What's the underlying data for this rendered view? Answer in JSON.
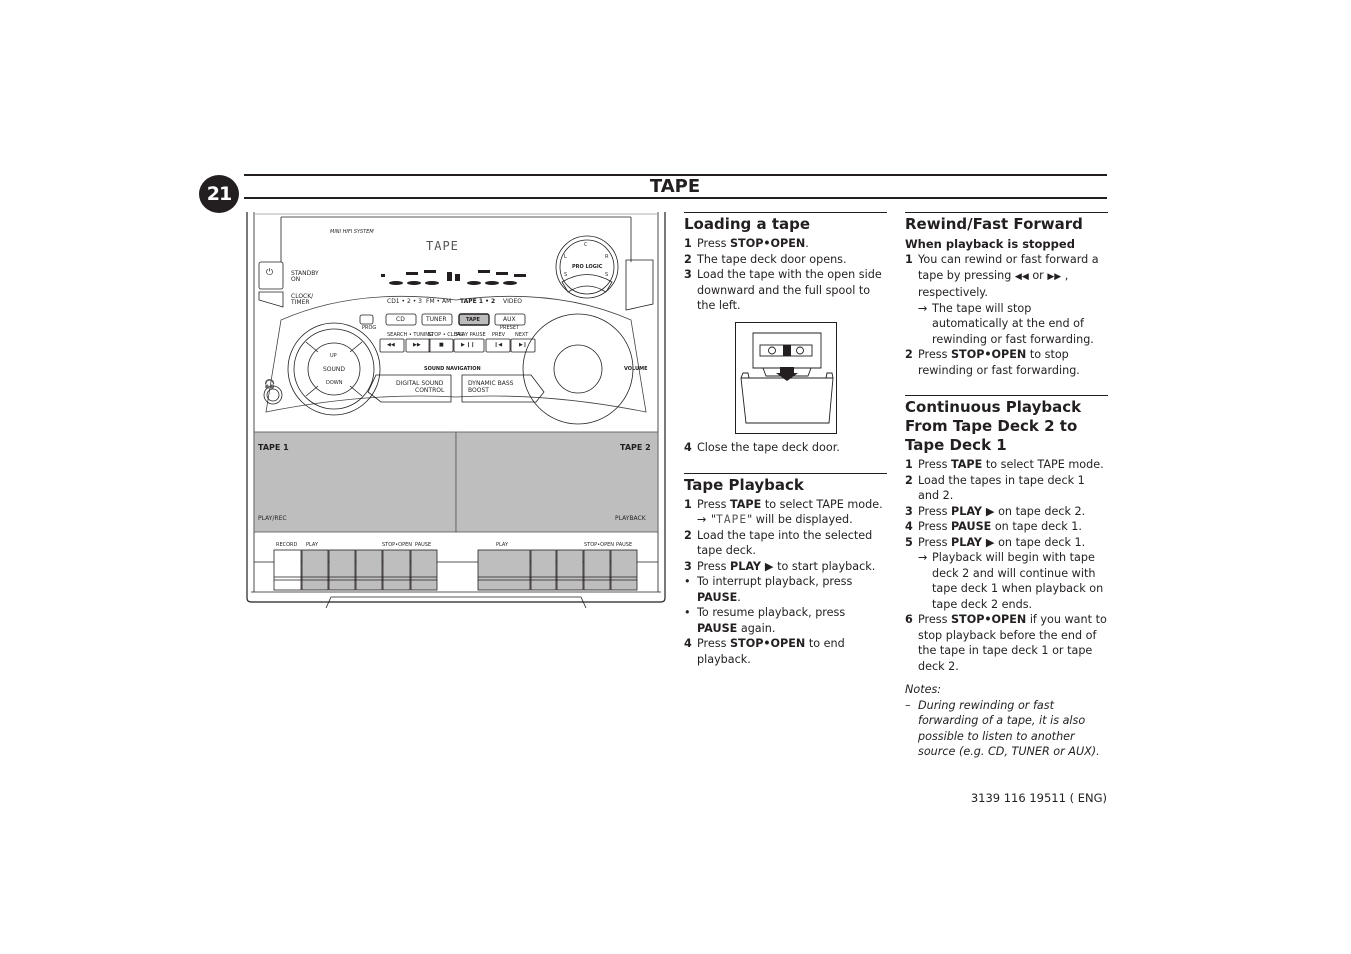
{
  "page": {
    "number": "21",
    "title": "TAPE",
    "footer_code": "3139 116 19511 ( ENG)"
  },
  "device": {
    "brand_label": "MINI HIFI SYSTEM",
    "display_text": "TAPE",
    "standby_label": "STANDBY",
    "standby_label2": "ON",
    "clock_label": "CLOCK/",
    "clock_label2": "TIMER",
    "pro_logic_label": "PRO LOGIC",
    "pro_logic_keys": [
      "C",
      "L",
      "R",
      "S",
      "S"
    ],
    "source_labels": [
      "CD1 • 2 • 3",
      "FM • AM",
      "TAPE 1 • 2",
      "VIDEO"
    ],
    "source_buttons": [
      "CD",
      "TUNER",
      "TAPE",
      "AUX"
    ],
    "prog_label": "PROG",
    "preset_label": "PRESET",
    "transport_labels": [
      "SEARCH • TUNING",
      "STOP • CLEAR",
      "PLAY PAUSE",
      "PREV",
      "NEXT"
    ],
    "transport_glyphs": [
      "◀◀",
      "▶▶",
      "■",
      "▶  ❙❙",
      "❙◀",
      "▶❙"
    ],
    "sound_label": "SOUND",
    "up_label": "UP",
    "down_label": "DOWN",
    "sound_navigation_label": "SOUND NAVIGATION",
    "dsc_label": "DIGITAL SOUND",
    "dsc_label2": "CONTROL",
    "dbb_label": "DYNAMIC BASS",
    "dbb_label2": "BOOST",
    "volume_label": "VOLUME",
    "tape1_label": "TAPE 1",
    "tape1_sub": "PLAY/REC",
    "tape2_label": "TAPE 2",
    "tape2_sub": "PLAYBACK",
    "deck1_keys": [
      "RECORD",
      "PLAY",
      "STOP•OPEN",
      "PAUSE"
    ],
    "deck2_keys": [
      "PLAY",
      "STOP•OPEN",
      "PAUSE"
    ]
  },
  "loading": {
    "heading": "Loading a tape",
    "steps": [
      {
        "num": "1",
        "pre": "Press ",
        "bold": "STOP•OPEN",
        "post": "."
      },
      {
        "num": "2",
        "text": "The tape deck door opens."
      },
      {
        "num": "3",
        "text": "Load the tape with the open side downward and the full spool to the left."
      },
      {
        "num": "4",
        "text": "Close the tape deck door."
      }
    ]
  },
  "playback": {
    "heading": "Tape Playback",
    "step1_num": "1",
    "step1_pre": "Press ",
    "step1_bold": "TAPE",
    "step1_post": " to select TAPE mode.",
    "step1_arrow": "→",
    "step1_result_pre": "\"",
    "step1_result_lcd": "TAPE",
    "step1_result_post": "\" will be displayed.",
    "step2_num": "2",
    "step2_text": "Load the tape into the selected tape deck.",
    "step3_num": "3",
    "step3_pre": "Press ",
    "step3_bold": "PLAY ▶",
    "step3_post": "  to start playback.",
    "bullet_glyph": "•",
    "bullet1_pre": "To interrupt playback, press ",
    "bullet1_bold": "PAUSE",
    "bullet1_post": ".",
    "bullet2_pre": "To resume playback, press ",
    "bullet2_bold": "PAUSE",
    "bullet2_post": " again.",
    "step4_num": "4",
    "step4_pre": "Press ",
    "step4_bold": "STOP•OPEN",
    "step4_post": " to end playback."
  },
  "rewind": {
    "heading": "Rewind/Fast Forward",
    "subheading": "When playback is stopped",
    "step1_num": "1",
    "step1_pre": "You can rewind or fast forward a tape by pressing ",
    "step1_rew": "◀◀",
    "step1_mid": " or ",
    "step1_ff": "▶▶",
    "step1_post": " , respectively.",
    "step1_arrow": "→",
    "step1_result": "The tape will stop automatically at the end of rewinding or fast forwarding.",
    "step2_num": "2",
    "step2_pre": "Press ",
    "step2_bold": "STOP•OPEN",
    "step2_post": " to stop rewinding or fast forwarding."
  },
  "continuous": {
    "heading": "Continuous Playback From Tape Deck 2 to Tape Deck 1",
    "s1_num": "1",
    "s1_pre": "Press ",
    "s1_bold": "TAPE",
    "s1_post": " to select TAPE mode.",
    "s2_num": "2",
    "s2_text": "Load the tapes in tape deck 1 and 2.",
    "s3_num": "3",
    "s3_pre": "Press ",
    "s3_bold": "PLAY ▶",
    "s3_post": " on tape deck 2.",
    "s4_num": "4",
    "s4_pre": "Press ",
    "s4_bold": "PAUSE",
    "s4_post": " on tape deck 1.",
    "s5_num": "5",
    "s5_pre": "Press ",
    "s5_bold": "PLAY ▶",
    "s5_post": " on tape deck 1.",
    "s5_arrow": "→",
    "s5_result": "Playback will begin with tape deck 2 and will continue with tape deck 1 when playback on tape deck 2 ends.",
    "s6_num": "6",
    "s6_pre": "Press ",
    "s6_bold": "STOP•OPEN",
    "s6_post": " if you want to stop playback before the end of the tape in tape deck 1 or tape deck 2.",
    "notes_label": "Notes:",
    "note_dash": "–",
    "note_text": "During rewinding or fast forwarding of a tape, it is also possible to listen to another source (e.g. CD, TUNER or AUX)."
  }
}
